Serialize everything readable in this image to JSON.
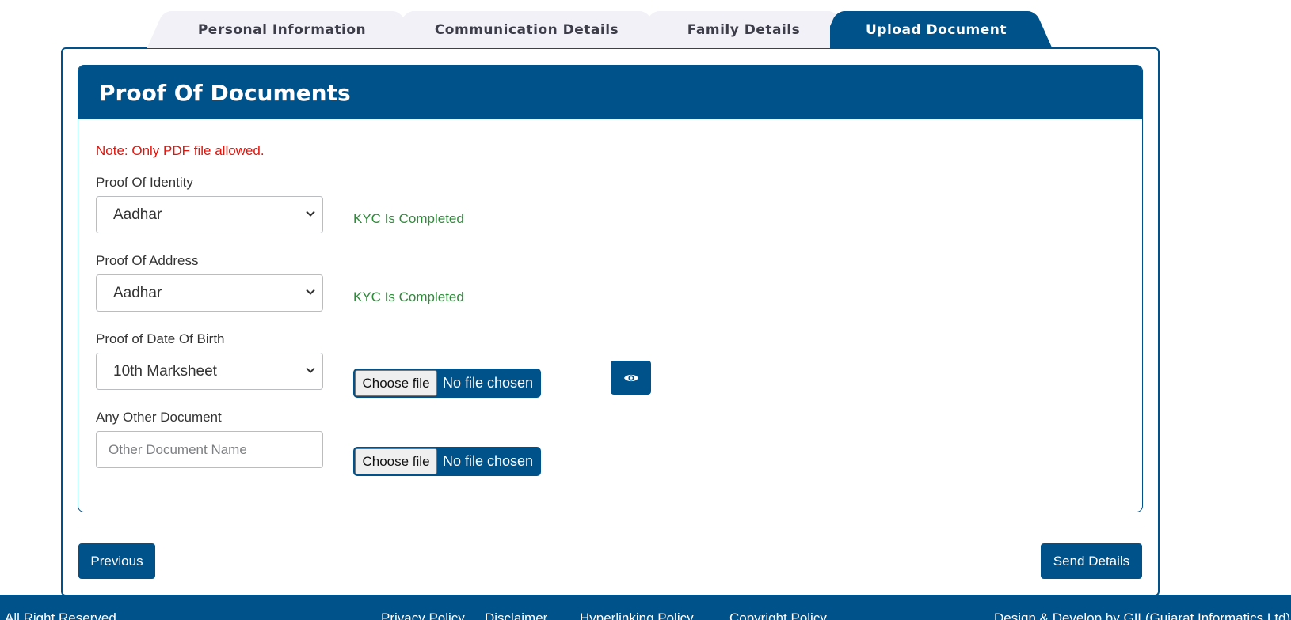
{
  "tabs": [
    {
      "label": "Personal Information",
      "active": false
    },
    {
      "label": "Communication Details",
      "active": false
    },
    {
      "label": "Family Details",
      "active": false
    },
    {
      "label": "Upload Document",
      "active": true
    }
  ],
  "section": {
    "title": "Proof Of Documents",
    "note": "Note: Only PDF file allowed."
  },
  "fields": {
    "identity": {
      "label": "Proof Of Identity",
      "value": "Aadhar",
      "status": "KYC Is Completed"
    },
    "address": {
      "label": "Proof Of Address",
      "value": "Aadhar",
      "status": "KYC Is Completed"
    },
    "dob": {
      "label": "Proof of Date Of Birth",
      "value": "10th Marksheet",
      "choose_label": "Choose file",
      "file_status": "No file chosen"
    },
    "other": {
      "label": "Any Other Document",
      "placeholder": "Other Document Name",
      "choose_label": "Choose file",
      "file_status": "No file chosen"
    }
  },
  "icons": {
    "view": "eye-icon",
    "dropdown": "chevron-down-icon"
  },
  "buttons": {
    "previous": "Previous",
    "send": "Send Details"
  },
  "footer": {
    "left": "All Right Reserved",
    "links": [
      "Privacy Policy",
      "Disclaimer",
      "Hyperlinking Policy",
      "Copyright Policy"
    ],
    "right": "Design & Develop by GIL(Gujarat Informatics Ltd)"
  },
  "colors": {
    "primary": "#00528a",
    "tab_bg": "#f2f1f7",
    "note": "#e3140c",
    "kyc": "#2e8b3a"
  }
}
